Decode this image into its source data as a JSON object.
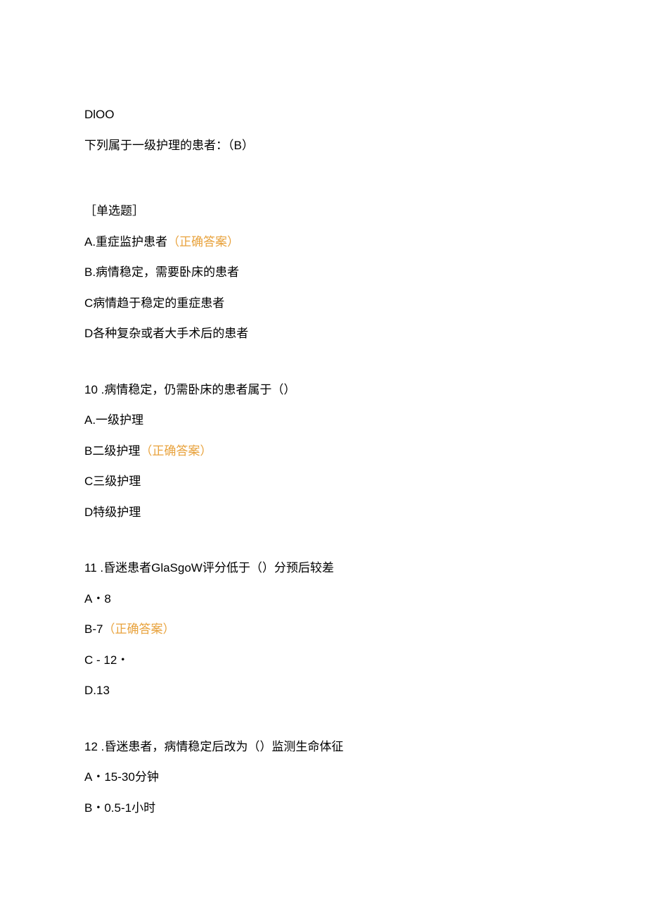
{
  "header_text": "DlOO",
  "intro_line": "下列属于一级护理的患者：（B）",
  "q9": {
    "type_label": "［单选题］",
    "options": {
      "a_prefix": "A.重症监护患者",
      "a_correct": "（正确答案）",
      "b": "B.病情稳定，需要卧床的患者",
      "c": "C病情趋于稳定的重症患者",
      "d": "D各种复杂或者大手术后的患者"
    }
  },
  "q10": {
    "stem": "10  .病情稳定，仍需卧床的患者属于（）",
    "options": {
      "a": "A.一级护理",
      "b_prefix": "B二级护理",
      "b_correct": "（正确答案）",
      "c": "C三级护理",
      "d": "D特级护理"
    }
  },
  "q11": {
    "stem": "11  .昏迷患者GlaSgoW评分低于（）分预后较差",
    "options": {
      "a": "A・8",
      "b_prefix": "B-7",
      "b_correct": "（正确答案）",
      "c": "C - 12・",
      "d": "D.13"
    }
  },
  "q12": {
    "stem": "12  .昏迷患者，病情稳定后改为（）监测生命体征",
    "options": {
      "a": "A・15-30分钟",
      "b": "B・0.5-1小时"
    }
  }
}
